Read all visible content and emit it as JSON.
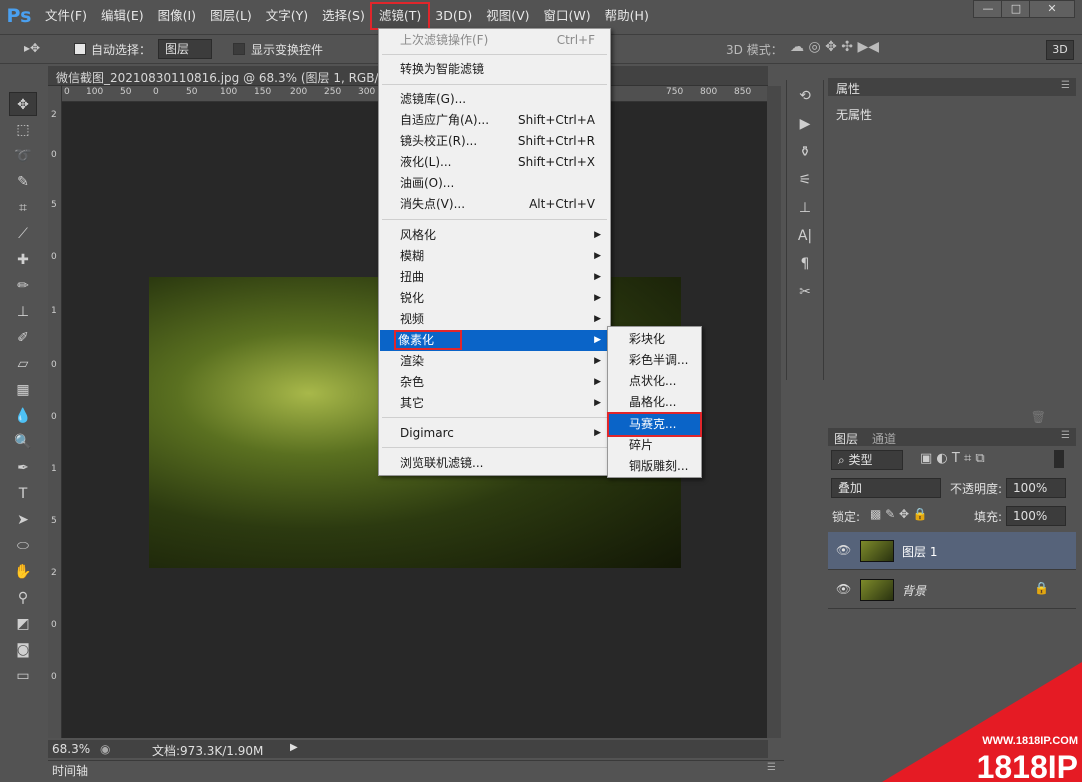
{
  "app": {
    "logo": "Ps"
  },
  "menubar": {
    "items": [
      "文件(F)",
      "编辑(E)",
      "图像(I)",
      "图层(L)",
      "文字(Y)",
      "选择(S)",
      "滤镜(T)",
      "3D(D)",
      "视图(V)",
      "窗口(W)",
      "帮助(H)"
    ],
    "active": "滤镜(T)"
  },
  "window_buttons": [
    "—",
    "□",
    "✕"
  ],
  "options": {
    "auto_select_label": "自动选择：",
    "auto_select_value": "图层",
    "show_transform_label": "显示变换控件",
    "mode3d_label": "3D 模式：",
    "btn3d": "3D"
  },
  "document": {
    "tab_title": "微信截图_20210830110816.jpg @ 68.3% (图层 1, RGB/8#) *",
    "zoom": "68.3%",
    "doc_info": "文档:973.3K/1.90M"
  },
  "ruler": {
    "h_ticks": [
      "0",
      "100",
      "50",
      "0",
      "50",
      "100",
      "150",
      "200",
      "250",
      "300",
      "750",
      "800",
      "850"
    ],
    "v_ticks": [
      "2",
      "0",
      "5",
      "0",
      "1",
      "0",
      "0",
      "1",
      "5",
      "2",
      "0",
      "0"
    ]
  },
  "timeline_label": "时间轴",
  "filter_menu": {
    "items": [
      {
        "label": "上次滤镜操作(F)",
        "shortcut": "Ctrl+F",
        "disabled": true
      },
      {
        "label": "转换为智能滤镜"
      },
      {
        "label": "滤镜库(G)..."
      },
      {
        "label": "自适应广角(A)...",
        "shortcut": "Shift+Ctrl+A"
      },
      {
        "label": "镜头校正(R)...",
        "shortcut": "Shift+Ctrl+R"
      },
      {
        "label": "液化(L)...",
        "shortcut": "Shift+Ctrl+X"
      },
      {
        "label": "油画(O)..."
      },
      {
        "label": "消失点(V)...",
        "shortcut": "Alt+Ctrl+V"
      },
      {
        "label": "风格化",
        "sub": true
      },
      {
        "label": "模糊",
        "sub": true
      },
      {
        "label": "扭曲",
        "sub": true
      },
      {
        "label": "锐化",
        "sub": true
      },
      {
        "label": "视频",
        "sub": true
      },
      {
        "label": "像素化",
        "sub": true,
        "highlight": true
      },
      {
        "label": "渲染",
        "sub": true
      },
      {
        "label": "杂色",
        "sub": true
      },
      {
        "label": "其它",
        "sub": true
      },
      {
        "label": "Digimarc",
        "sub": true
      },
      {
        "label": "浏览联机滤镜..."
      }
    ]
  },
  "pixelate_submenu": {
    "items": [
      "彩块化",
      "彩色半调...",
      "点状化...",
      "晶格化...",
      "马赛克...",
      "碎片",
      "铜版雕刻..."
    ],
    "highlight": "马赛克..."
  },
  "properties": {
    "tab": "属性",
    "content": "无属性"
  },
  "layers_panel": {
    "tabs": [
      "图层",
      "通道"
    ],
    "filter_kind": "类型",
    "blend_mode": "叠加",
    "opacity_label": "不透明度:",
    "opacity_value": "100%",
    "lock_label": "锁定:",
    "fill_label": "填充:",
    "fill_value": "100%",
    "layers": [
      {
        "name": "图层 1",
        "selected": true
      },
      {
        "name": "背景",
        "locked": true
      }
    ]
  },
  "watermark": {
    "url": "WWW.1818IP.COM",
    "brand": "1818IP"
  },
  "colors": {
    "accent": "#0a64c8",
    "highlight_box": "#e0262b",
    "ps_blue": "#4aa0f0"
  }
}
